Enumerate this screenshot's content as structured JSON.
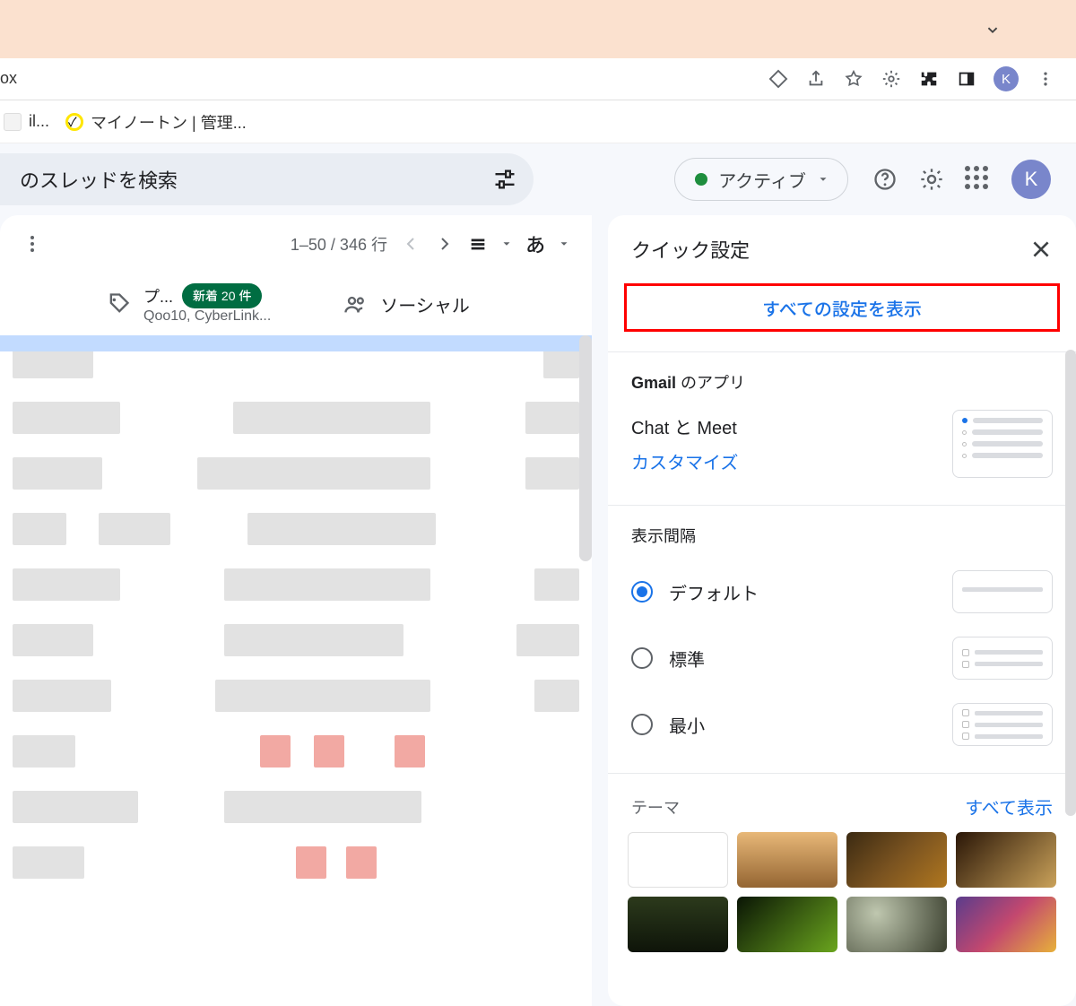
{
  "banner": {},
  "browser": {
    "page_title_fragment": "ox",
    "avatar_letter": "K"
  },
  "bookmarks": {
    "item1_suffix": "il...",
    "item2": "マイノートン | 管理..."
  },
  "search": {
    "placeholder": "のスレッドを検索"
  },
  "status": {
    "label": "アクティブ"
  },
  "inbox_toolbar": {
    "range": "1–50 / 346 行",
    "lang": "あ"
  },
  "tabs": {
    "promo_label": "プ...",
    "promo_badge": "新着 20 件",
    "promo_sub": "Qoo10, CyberLink...",
    "social_label": "ソーシャル"
  },
  "qs": {
    "title": "クイック設定",
    "see_all": "すべての設定を表示",
    "apps_title_bold": "Gmail",
    "apps_title_rest": " のアプリ",
    "chatmeet": "Chat と Meet",
    "customize": "カスタマイズ",
    "density_title": "表示間隔",
    "density_default": "デフォルト",
    "density_standard": "標準",
    "density_compact": "最小",
    "theme_title": "テーマ",
    "theme_all": "すべて表示"
  },
  "avatar_letter": "K"
}
